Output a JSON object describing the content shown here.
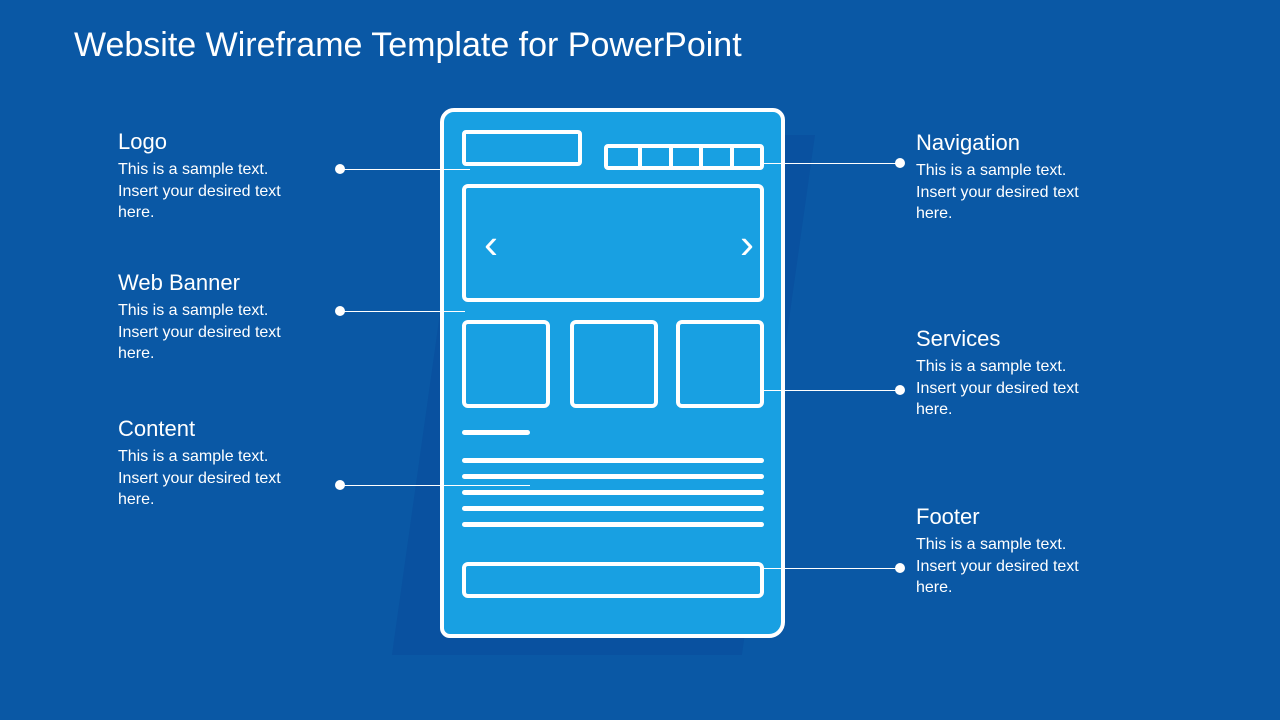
{
  "title": "Website Wireframe Template for PowerPoint",
  "sample_body": "This is a sample text.\nInsert your desired text\nhere.",
  "callouts": {
    "logo": {
      "heading": "Logo"
    },
    "web_banner": {
      "heading": "Web Banner"
    },
    "content": {
      "heading": "Content"
    },
    "navigation": {
      "heading": "Navigation"
    },
    "services": {
      "heading": "Services"
    },
    "footer": {
      "heading": "Footer"
    }
  },
  "colors": {
    "background": "#0a58a5",
    "wireframe_fill": "#18a0e2",
    "stroke": "#ffffff"
  },
  "wireframe": {
    "sections": [
      "logo",
      "navigation",
      "banner",
      "services",
      "content",
      "footer"
    ],
    "nav_items": 5,
    "service_boxes": 3,
    "content_lines": 5
  }
}
